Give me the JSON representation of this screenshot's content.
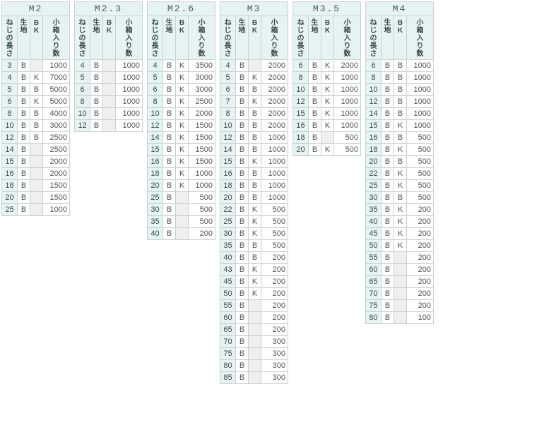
{
  "headers": {
    "length": [
      "ね",
      "じ",
      "の",
      "長",
      "さ"
    ],
    "col1": [
      "生",
      "地"
    ],
    "col2": [
      "B",
      "K"
    ],
    "qty": [
      "小",
      "箱",
      "入",
      "り",
      "数"
    ]
  },
  "tables": [
    {
      "title": "M2",
      "rows": [
        {
          "len": "3",
          "c1": "B",
          "c2": "",
          "qty": "1000"
        },
        {
          "len": "4",
          "c1": "B",
          "c2": "K",
          "qty": "7000"
        },
        {
          "len": "5",
          "c1": "B",
          "c2": "B",
          "qty": "5000"
        },
        {
          "len": "6",
          "c1": "B",
          "c2": "K",
          "qty": "5000"
        },
        {
          "len": "8",
          "c1": "B",
          "c2": "B",
          "qty": "4000"
        },
        {
          "len": "10",
          "c1": "B",
          "c2": "B",
          "qty": "3000"
        },
        {
          "len": "12",
          "c1": "B",
          "c2": "B",
          "qty": "2500"
        },
        {
          "len": "14",
          "c1": "B",
          "c2": "",
          "qty": "2500"
        },
        {
          "len": "15",
          "c1": "B",
          "c2": "",
          "qty": "2000"
        },
        {
          "len": "16",
          "c1": "B",
          "c2": "",
          "qty": "2000"
        },
        {
          "len": "18",
          "c1": "B",
          "c2": "",
          "qty": "1500"
        },
        {
          "len": "20",
          "c1": "B",
          "c2": "",
          "qty": "1500"
        },
        {
          "len": "25",
          "c1": "B",
          "c2": "",
          "qty": "1000"
        }
      ]
    },
    {
      "title": "M2.3",
      "rows": [
        {
          "len": "4",
          "c1": "B",
          "c2": "",
          "qty": "1000"
        },
        {
          "len": "5",
          "c1": "B",
          "c2": "",
          "qty": "1000"
        },
        {
          "len": "6",
          "c1": "B",
          "c2": "",
          "qty": "1000"
        },
        {
          "len": "8",
          "c1": "B",
          "c2": "",
          "qty": "1000"
        },
        {
          "len": "10",
          "c1": "B",
          "c2": "",
          "qty": "1000"
        },
        {
          "len": "12",
          "c1": "B",
          "c2": "",
          "qty": "1000"
        }
      ]
    },
    {
      "title": "M2.6",
      "rows": [
        {
          "len": "4",
          "c1": "B",
          "c2": "K",
          "qty": "3500"
        },
        {
          "len": "5",
          "c1": "B",
          "c2": "K",
          "qty": "3000"
        },
        {
          "len": "6",
          "c1": "B",
          "c2": "K",
          "qty": "3000"
        },
        {
          "len": "8",
          "c1": "B",
          "c2": "K",
          "qty": "2500"
        },
        {
          "len": "10",
          "c1": "B",
          "c2": "K",
          "qty": "2000"
        },
        {
          "len": "12",
          "c1": "B",
          "c2": "K",
          "qty": "1500"
        },
        {
          "len": "14",
          "c1": "B",
          "c2": "K",
          "qty": "1500"
        },
        {
          "len": "15",
          "c1": "B",
          "c2": "K",
          "qty": "1500"
        },
        {
          "len": "16",
          "c1": "B",
          "c2": "K",
          "qty": "1500"
        },
        {
          "len": "18",
          "c1": "B",
          "c2": "K",
          "qty": "1000"
        },
        {
          "len": "20",
          "c1": "B",
          "c2": "K",
          "qty": "1000"
        },
        {
          "len": "25",
          "c1": "B",
          "c2": "",
          "qty": "500"
        },
        {
          "len": "30",
          "c1": "B",
          "c2": "",
          "qty": "500"
        },
        {
          "len": "35",
          "c1": "B",
          "c2": "",
          "qty": "500"
        },
        {
          "len": "40",
          "c1": "B",
          "c2": "",
          "qty": "200"
        }
      ]
    },
    {
      "title": "M3",
      "rows": [
        {
          "len": "4",
          "c1": "B",
          "c2": "",
          "qty": "2000"
        },
        {
          "len": "5",
          "c1": "B",
          "c2": "K",
          "qty": "2000"
        },
        {
          "len": "6",
          "c1": "B",
          "c2": "B",
          "qty": "2000"
        },
        {
          "len": "7",
          "c1": "B",
          "c2": "K",
          "qty": "2000"
        },
        {
          "len": "8",
          "c1": "B",
          "c2": "B",
          "qty": "2000"
        },
        {
          "len": "10",
          "c1": "B",
          "c2": "B",
          "qty": "2000"
        },
        {
          "len": "12",
          "c1": "B",
          "c2": "B",
          "qty": "1000"
        },
        {
          "len": "14",
          "c1": "B",
          "c2": "B",
          "qty": "1000"
        },
        {
          "len": "15",
          "c1": "B",
          "c2": "K",
          "qty": "1000"
        },
        {
          "len": "16",
          "c1": "B",
          "c2": "B",
          "qty": "1000"
        },
        {
          "len": "18",
          "c1": "B",
          "c2": "B",
          "qty": "1000"
        },
        {
          "len": "20",
          "c1": "B",
          "c2": "B",
          "qty": "1000"
        },
        {
          "len": "22",
          "c1": "B",
          "c2": "K",
          "qty": "500"
        },
        {
          "len": "25",
          "c1": "B",
          "c2": "K",
          "qty": "500"
        },
        {
          "len": "30",
          "c1": "B",
          "c2": "K",
          "qty": "500"
        },
        {
          "len": "35",
          "c1": "B",
          "c2": "B",
          "qty": "500"
        },
        {
          "len": "40",
          "c1": "B",
          "c2": "B",
          "qty": "200"
        },
        {
          "len": "43",
          "c1": "B",
          "c2": "K",
          "qty": "200"
        },
        {
          "len": "45",
          "c1": "B",
          "c2": "K",
          "qty": "200"
        },
        {
          "len": "50",
          "c1": "B",
          "c2": "K",
          "qty": "200"
        },
        {
          "len": "55",
          "c1": "B",
          "c2": "",
          "qty": "200"
        },
        {
          "len": "60",
          "c1": "B",
          "c2": "",
          "qty": "200"
        },
        {
          "len": "65",
          "c1": "B",
          "c2": "",
          "qty": "200"
        },
        {
          "len": "70",
          "c1": "B",
          "c2": "",
          "qty": "300"
        },
        {
          "len": "75",
          "c1": "B",
          "c2": "",
          "qty": "300"
        },
        {
          "len": "80",
          "c1": "B",
          "c2": "",
          "qty": "300"
        },
        {
          "len": "85",
          "c1": "B",
          "c2": "",
          "qty": "300"
        }
      ]
    },
    {
      "title": "M3.5",
      "rows": [
        {
          "len": "6",
          "c1": "B",
          "c2": "K",
          "qty": "2000"
        },
        {
          "len": "8",
          "c1": "B",
          "c2": "K",
          "qty": "1000"
        },
        {
          "len": "10",
          "c1": "B",
          "c2": "K",
          "qty": "1000"
        },
        {
          "len": "12",
          "c1": "B",
          "c2": "K",
          "qty": "1000"
        },
        {
          "len": "15",
          "c1": "B",
          "c2": "K",
          "qty": "1000"
        },
        {
          "len": "16",
          "c1": "B",
          "c2": "K",
          "qty": "1000"
        },
        {
          "len": "18",
          "c1": "B",
          "c2": "",
          "qty": "500"
        },
        {
          "len": "20",
          "c1": "B",
          "c2": "K",
          "qty": "500"
        }
      ]
    },
    {
      "title": "M4",
      "rows": [
        {
          "len": "6",
          "c1": "B",
          "c2": "B",
          "qty": "1000"
        },
        {
          "len": "8",
          "c1": "B",
          "c2": "B",
          "qty": "1000"
        },
        {
          "len": "10",
          "c1": "B",
          "c2": "B",
          "qty": "1000"
        },
        {
          "len": "12",
          "c1": "B",
          "c2": "B",
          "qty": "1000"
        },
        {
          "len": "14",
          "c1": "B",
          "c2": "B",
          "qty": "1000"
        },
        {
          "len": "15",
          "c1": "B",
          "c2": "K",
          "qty": "1000"
        },
        {
          "len": "16",
          "c1": "B",
          "c2": "B",
          "qty": "500"
        },
        {
          "len": "18",
          "c1": "B",
          "c2": "K",
          "qty": "500"
        },
        {
          "len": "20",
          "c1": "B",
          "c2": "B",
          "qty": "500"
        },
        {
          "len": "22",
          "c1": "B",
          "c2": "K",
          "qty": "500"
        },
        {
          "len": "25",
          "c1": "B",
          "c2": "K",
          "qty": "500"
        },
        {
          "len": "30",
          "c1": "B",
          "c2": "B",
          "qty": "500"
        },
        {
          "len": "35",
          "c1": "B",
          "c2": "K",
          "qty": "200"
        },
        {
          "len": "40",
          "c1": "B",
          "c2": "K",
          "qty": "200"
        },
        {
          "len": "45",
          "c1": "B",
          "c2": "K",
          "qty": "200"
        },
        {
          "len": "50",
          "c1": "B",
          "c2": "K",
          "qty": "200"
        },
        {
          "len": "55",
          "c1": "B",
          "c2": "",
          "qty": "200"
        },
        {
          "len": "60",
          "c1": "B",
          "c2": "",
          "qty": "200"
        },
        {
          "len": "65",
          "c1": "B",
          "c2": "",
          "qty": "200"
        },
        {
          "len": "70",
          "c1": "B",
          "c2": "",
          "qty": "200"
        },
        {
          "len": "75",
          "c1": "B",
          "c2": "",
          "qty": "200"
        },
        {
          "len": "80",
          "c1": "B",
          "c2": "",
          "qty": "100"
        }
      ]
    }
  ]
}
